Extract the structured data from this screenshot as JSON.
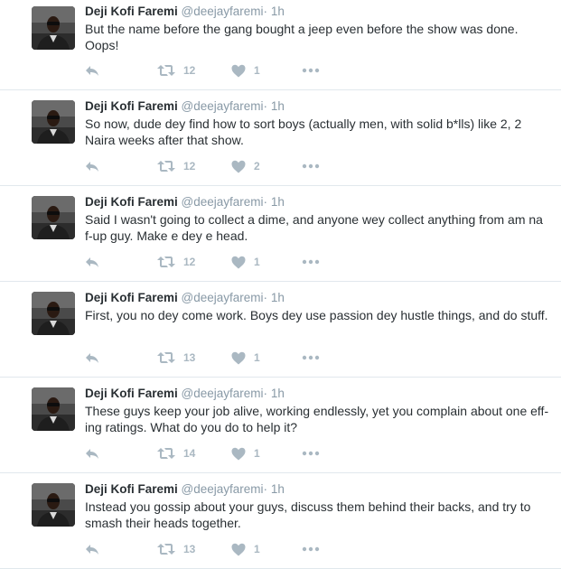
{
  "author": {
    "name": "Deji Kofi Faremi",
    "handle": "@deejayfaremi",
    "separator": "·"
  },
  "tweets": [
    {
      "time": "1h",
      "text": "But the name before the gang bought a jeep even before the show was done. Oops!",
      "retweets": "12",
      "likes": "1"
    },
    {
      "time": "1h",
      "text": "So now, dude dey find how to sort boys (actually men, with solid b*lls) like 2, 2 Naira weeks after that show.",
      "retweets": "12",
      "likes": "2"
    },
    {
      "time": "1h",
      "text": "Said I wasn't going to collect a dime, and anyone wey collect anything from am na f-up guy. Make e dey e head.",
      "retweets": "12",
      "likes": "1"
    },
    {
      "time": "1h",
      "text": "First, you no dey come work. Boys dey use passion dey hustle things, and do stuff.",
      "retweets": "13",
      "likes": "1"
    },
    {
      "time": "1h",
      "text": "These guys keep your job alive, working endlessly, yet you complain about one eff-ing ratings. What do you do to help it?",
      "retweets": "14",
      "likes": "1"
    },
    {
      "time": "1h",
      "text": "Instead you gossip about your guys, discuss them behind their backs, and try to smash their heads together.",
      "retweets": "13",
      "likes": "1"
    }
  ],
  "icons": {
    "reply": "reply-icon",
    "retweet": "retweet-icon",
    "like": "heart-icon",
    "more": "more-icon"
  },
  "colors": {
    "text": "#292f33",
    "muted": "#8899a6",
    "icon": "#aab8c2",
    "divider": "#e1e8ed"
  }
}
